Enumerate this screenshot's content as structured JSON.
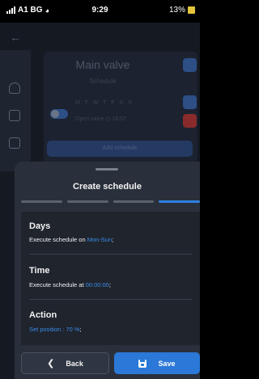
{
  "status_bar": {
    "carrier": "A1 BG",
    "time": "9:29",
    "battery": "13%"
  },
  "background": {
    "title": "Main valve",
    "subtitle": "Schedule",
    "days": "M T W T F S S",
    "open_label": "Open valve",
    "open_time": "16:57",
    "add_schedule": "Add schedule"
  },
  "sheet": {
    "title": "Create schedule",
    "steps_total": 4,
    "step_active": 4,
    "sections": {
      "days": {
        "heading": "Days",
        "prefix": "Execute schedule on ",
        "value": "Mon-Sun",
        "suffix": ";"
      },
      "time": {
        "heading": "Time",
        "prefix": "Execute schedule at ",
        "value": "00:00:00",
        "suffix": ";"
      },
      "action": {
        "heading": "Action",
        "value": "Set position : 70 %",
        "suffix": ";"
      }
    },
    "back_label": "Back",
    "save_label": "Save"
  },
  "colors": {
    "accent": "#2b78d8",
    "highlight": "#3b8dea",
    "sheet_bg": "#2a303b"
  },
  "icons": [
    "wifi-icon",
    "signal-icon",
    "battery-icon",
    "back-arrow-icon",
    "bell-icon",
    "chart-icon",
    "door-icon",
    "edit-icon",
    "delete-icon",
    "clock-icon",
    "chevron-left-icon",
    "save-icon"
  ]
}
